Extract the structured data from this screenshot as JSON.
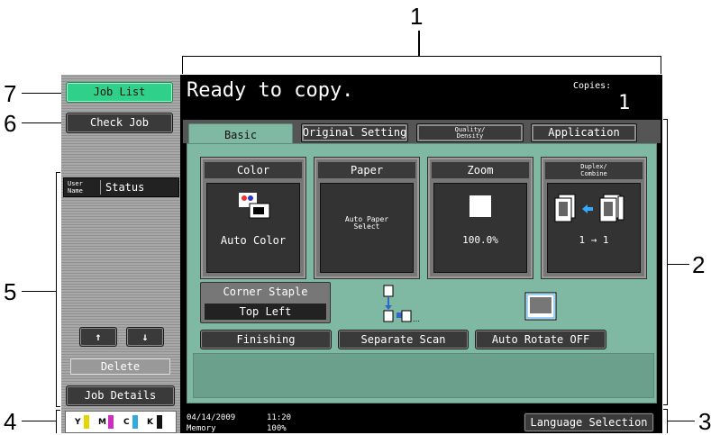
{
  "callouts": [
    "1",
    "2",
    "3",
    "4",
    "5",
    "6",
    "7"
  ],
  "left_panel": {
    "job_list_label": "Job List",
    "check_job_label": "Check Job",
    "col_user_name": "User\nName",
    "col_status": "Status",
    "up_arrow": "↑",
    "down_arrow": "↓",
    "delete_label": "Delete",
    "job_details_label": "Job Details",
    "toner": [
      "Y",
      "M",
      "C",
      "K"
    ],
    "toner_colors": [
      "#e8d400",
      "#cc2fbf",
      "#33aadd",
      "#111111"
    ]
  },
  "header": {
    "message": "Ready to copy.",
    "copies_label": "Copies:",
    "copies_value": "1"
  },
  "tabs": [
    {
      "label": "Basic"
    },
    {
      "label": "Original Setting"
    },
    {
      "label": "Quality/\nDensity"
    },
    {
      "label": "Application"
    }
  ],
  "cards": {
    "color": {
      "title": "Color",
      "value": "Auto Color"
    },
    "paper": {
      "title": "Paper",
      "value": "Auto Paper\nSelect"
    },
    "zoom": {
      "title": "Zoom",
      "value": "100.0%"
    },
    "duplex": {
      "title": "Duplex/\nCombine",
      "value": "1 → 1"
    }
  },
  "corner_staple": {
    "label": "Corner Staple",
    "value": "Top Left"
  },
  "buttons": {
    "finishing": "Finishing",
    "separate_scan": "Separate Scan",
    "auto_rotate": "Auto Rotate OFF"
  },
  "footer": {
    "date": "04/14/2009",
    "time": "11:20",
    "memory_label": "Memory",
    "memory_value": "100%",
    "language_label": "Language Selection"
  }
}
